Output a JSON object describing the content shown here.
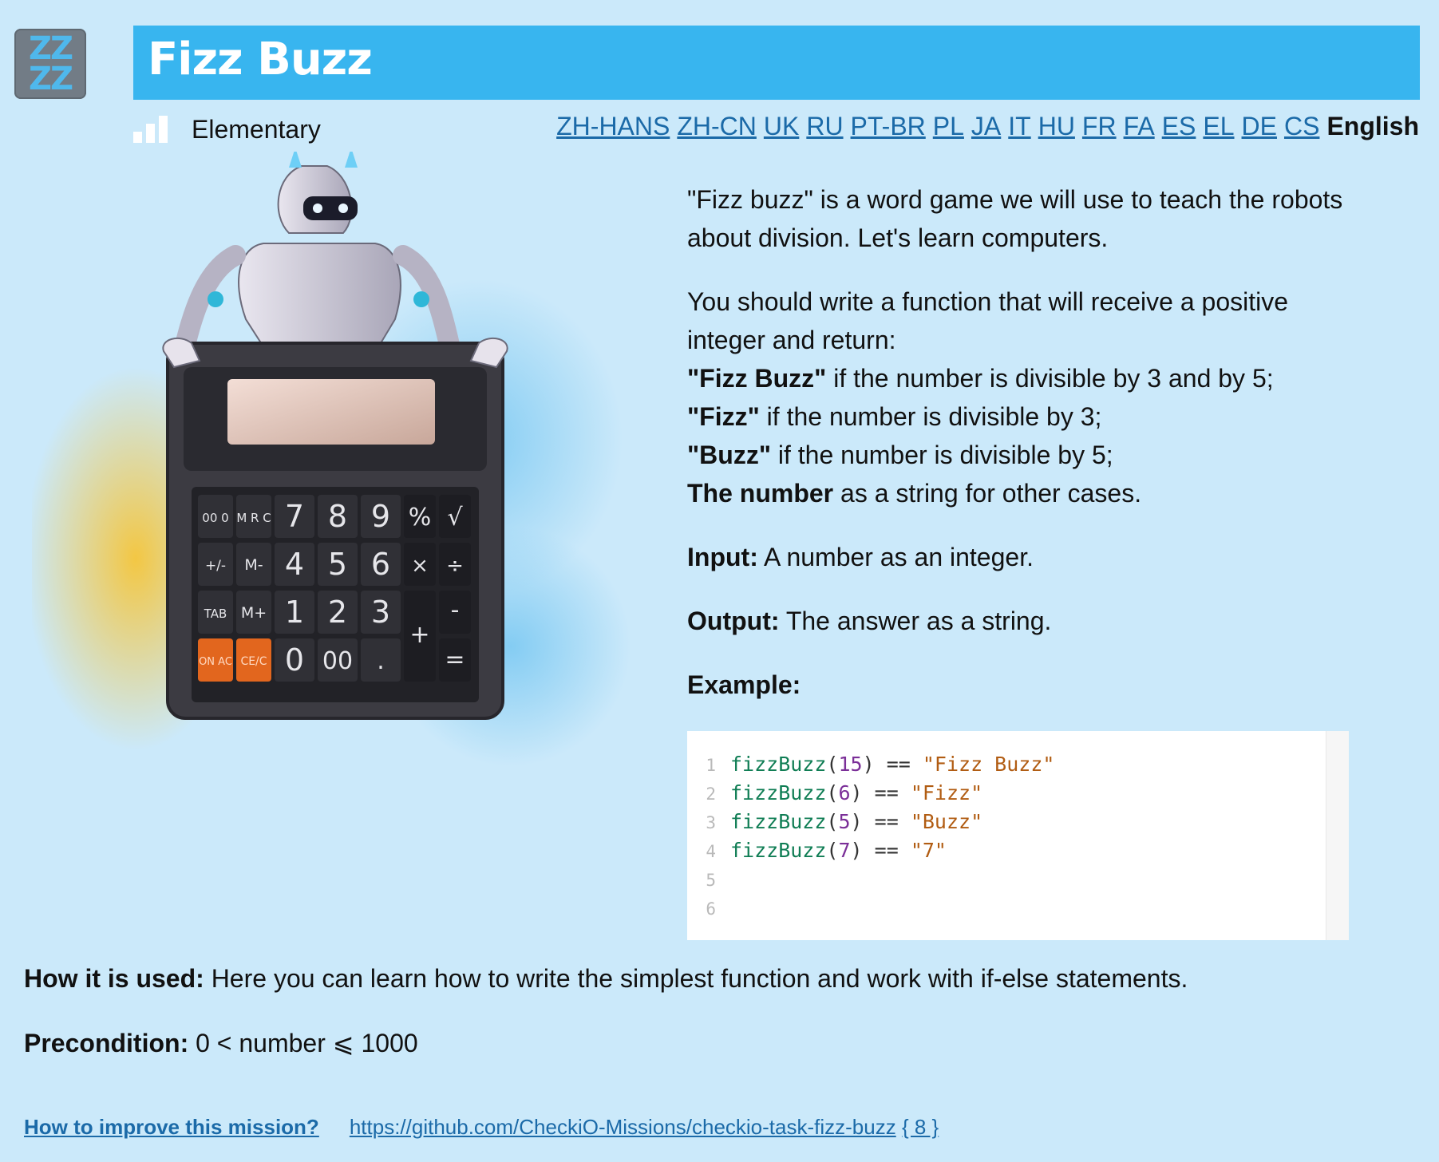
{
  "logo": {
    "text_top": "ZZ",
    "text_bottom": "ZZ"
  },
  "header": {
    "title": "Fizz Buzz"
  },
  "level": {
    "label": "Elementary"
  },
  "languages": {
    "links": [
      "ZH-HANS",
      "ZH-CN",
      "UK",
      "RU",
      "PT-BR",
      "PL",
      "JA",
      "IT",
      "HU",
      "FR",
      "FA",
      "ES",
      "EL",
      "DE",
      "CS"
    ],
    "current": "English"
  },
  "calculator": {
    "keys": [
      "00 0",
      "M R C",
      "7",
      "8",
      "9",
      "%",
      "√",
      "+/-",
      "M-",
      "4",
      "5",
      "6",
      "×",
      "÷",
      "TAB",
      "M+",
      "1",
      "2",
      "3",
      "+",
      "-",
      "ON AC",
      "CE/C",
      "0",
      "00",
      ".",
      "="
    ]
  },
  "description": {
    "intro": "\"Fizz buzz\" is a word game we will use to teach the robots about division. Let's learn computers.",
    "task": "You should write a function that will receive a positive integer and return:",
    "rules": [
      {
        "bold": "\"Fizz Buzz\"",
        "text": " if the number is divisible by 3 and by 5;"
      },
      {
        "bold": "\"Fizz\"",
        "text": " if the number is divisible by 3;"
      },
      {
        "bold": "\"Buzz\"",
        "text": " if the number is divisible by 5;"
      },
      {
        "bold": "The number",
        "text": " as a string for other cases."
      }
    ],
    "input_label": "Input:",
    "input_text": " A number as an integer.",
    "output_label": "Output:",
    "output_text": " The answer as a string.",
    "example_label": "Example:"
  },
  "code": {
    "line_numbers": [
      "1",
      "2",
      "3",
      "4",
      "5",
      "6"
    ],
    "lines": [
      {
        "fn": "fizzBuzz",
        "open": "(",
        "arg": "15",
        "close": ")",
        "op": " == ",
        "str": "\"Fizz Buzz\""
      },
      {
        "fn": "fizzBuzz",
        "open": "(",
        "arg": "6",
        "close": ")",
        "op": " == ",
        "str": "\"Fizz\""
      },
      {
        "fn": "fizzBuzz",
        "open": "(",
        "arg": "5",
        "close": ")",
        "op": " == ",
        "str": "\"Buzz\""
      },
      {
        "fn": "fizzBuzz",
        "open": "(",
        "arg": "7",
        "close": ")",
        "op": " == ",
        "str": "\"7\""
      }
    ]
  },
  "usage": {
    "label": "How it is used:",
    "text": " Here you can learn how to write the simplest function and work with if-else statements."
  },
  "precondition": {
    "label": "Precondition:",
    "text": " 0 < number ⩽ 1000"
  },
  "footer": {
    "improve": "How to improve this mission?",
    "repo": "https://github.com/CheckiO-Missions/checkio-task-fizz-buzz",
    "count": "{ 8 }"
  }
}
